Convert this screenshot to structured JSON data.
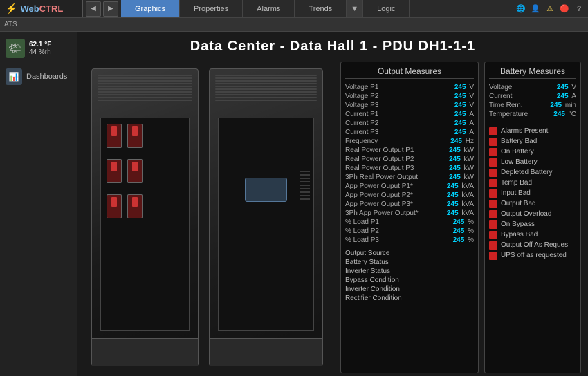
{
  "app": {
    "logo_web": "Web",
    "logo_ctrl": "CTRL",
    "logo_icon": "⚡"
  },
  "nav": {
    "back_label": "◀",
    "forward_label": "▶",
    "tabs": [
      {
        "label": "Graphics",
        "active": true
      },
      {
        "label": "Properties",
        "active": false
      },
      {
        "label": "Alarms",
        "active": false
      },
      {
        "label": "Trends",
        "active": false
      },
      {
        "label": "Logic",
        "active": false
      }
    ],
    "dropdown_arrow": "▼",
    "breadcrumb": "ATS",
    "icons": {
      "user": "👤",
      "settings": "⚙",
      "alert": "🔔",
      "help": "?",
      "network": "🌐"
    }
  },
  "sidebar": {
    "weather": {
      "icon": "🌤",
      "temp": "62.1",
      "temp_unit": "°F",
      "humidity": "44",
      "humidity_unit": "%rh"
    },
    "items": [
      {
        "label": "Dashboards",
        "icon": "📊"
      }
    ]
  },
  "page": {
    "title": "Data Center   -   Data Hall 1   -   PDU DH1-1-1"
  },
  "output_panel": {
    "title": "Output Measures",
    "rows": [
      {
        "label": "Voltage P1",
        "value": "245",
        "unit": "V"
      },
      {
        "label": "Voltage P2",
        "value": "245",
        "unit": "V"
      },
      {
        "label": "Voltage P3",
        "value": "245",
        "unit": "V"
      },
      {
        "label": "Current P1",
        "value": "245",
        "unit": "A"
      },
      {
        "label": "Current P2",
        "value": "245",
        "unit": "A"
      },
      {
        "label": "Current P3",
        "value": "245",
        "unit": "A"
      },
      {
        "label": "Frequency",
        "value": "245",
        "unit": "Hz"
      },
      {
        "label": "Real Power Output P1",
        "value": "245",
        "unit": "kW"
      },
      {
        "label": "Real Power Output P2",
        "value": "245",
        "unit": "kW"
      },
      {
        "label": "Real Power Output P3",
        "value": "245",
        "unit": "kW"
      },
      {
        "label": "3Ph Real Power Output",
        "value": "245",
        "unit": "kW"
      },
      {
        "label": "App Power Ouput P1*",
        "value": "245",
        "unit": "kVA"
      },
      {
        "label": "App Power Ouput P2*",
        "value": "245",
        "unit": "kVA"
      },
      {
        "label": "App Power Ouput P3*",
        "value": "245",
        "unit": "kVA"
      },
      {
        "label": "3Ph App Power Output*",
        "value": "245",
        "unit": "kVA"
      },
      {
        "label": "% Load P1",
        "value": "245",
        "unit": "%"
      },
      {
        "label": "% Load P2",
        "value": "245",
        "unit": "%"
      },
      {
        "label": "% Load P3",
        "value": "245",
        "unit": "%"
      }
    ],
    "status_items": [
      {
        "label": "Output Source"
      },
      {
        "label": "Battery Status"
      },
      {
        "label": "Inverter Status"
      },
      {
        "label": "Bypass Condition"
      },
      {
        "label": "Inverter Condition"
      },
      {
        "label": "Rectifier Condition"
      }
    ]
  },
  "battery_panel": {
    "title": "Battery Measures",
    "rows": [
      {
        "label": "Voltage",
        "value": "245",
        "unit": "V"
      },
      {
        "label": "Current",
        "value": "245",
        "unit": "A"
      },
      {
        "label": "Time Rem.",
        "value": "245",
        "unit": "min"
      },
      {
        "label": "Temperature",
        "value": "245",
        "unit": "°C"
      }
    ]
  },
  "alarms_panel": {
    "items": [
      {
        "label": "Alarms Present",
        "active": true
      },
      {
        "label": "Battery Bad",
        "active": true
      },
      {
        "label": "On Battery",
        "active": true
      },
      {
        "label": "Low Battery",
        "active": true
      },
      {
        "label": "Depleted Battery",
        "active": true
      },
      {
        "label": "Temp Bad",
        "active": true
      },
      {
        "label": "Input Bad",
        "active": true
      },
      {
        "label": "Output Bad",
        "active": true
      },
      {
        "label": "Output Overload",
        "active": true
      },
      {
        "label": "On Bypass",
        "active": true
      },
      {
        "label": "Bypass Bad",
        "active": true
      },
      {
        "label": "Output Off As Reques",
        "active": true
      },
      {
        "label": "UPS off as requested",
        "active": true
      }
    ]
  }
}
